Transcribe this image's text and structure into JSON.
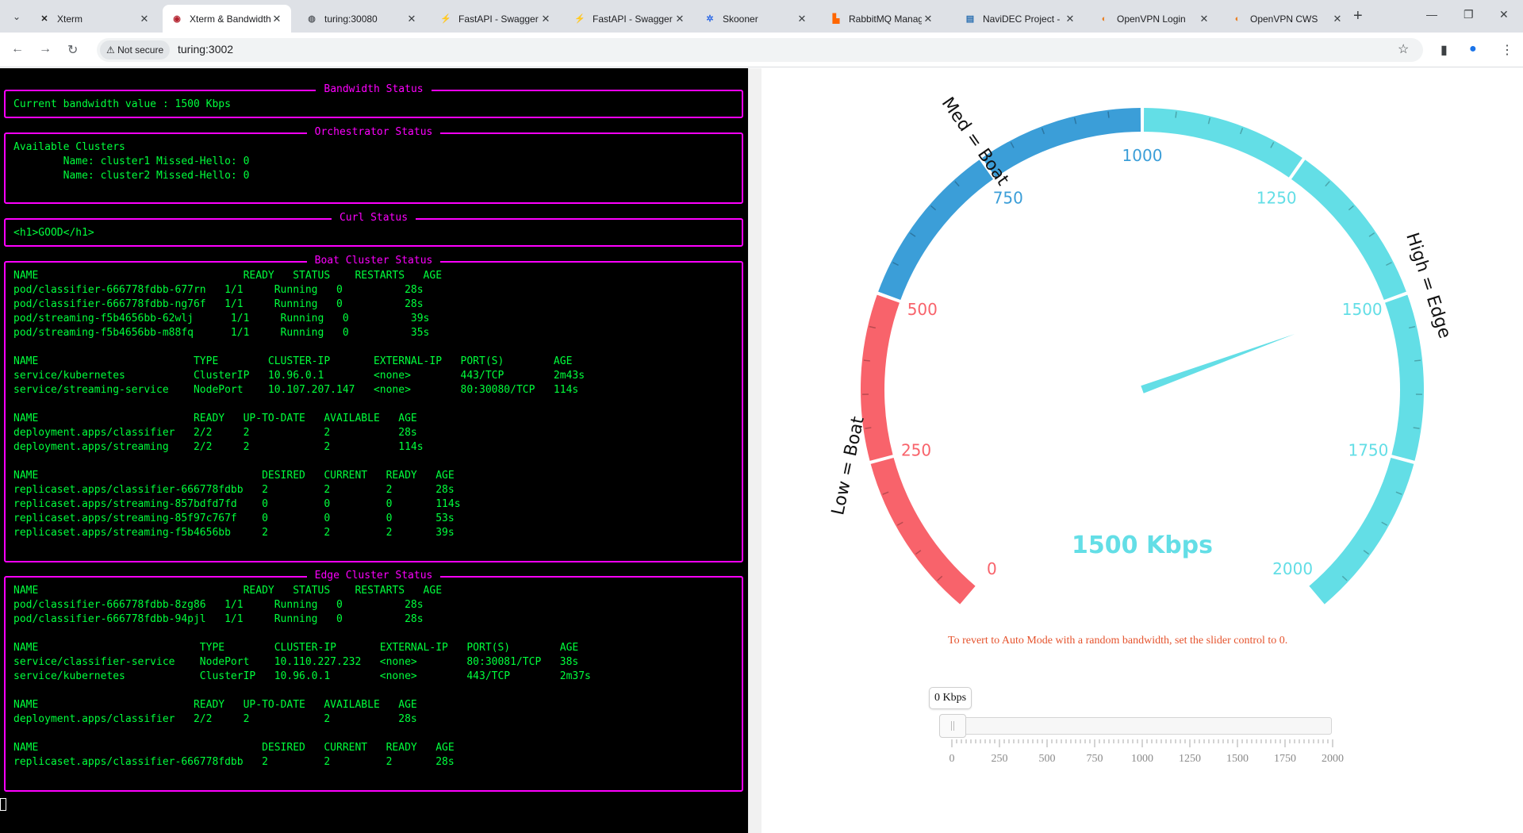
{
  "browser": {
    "tabs": [
      {
        "title": "Xterm",
        "icon": "xterm-icon",
        "active": false
      },
      {
        "title": "Xterm & Bandwidth",
        "icon": "app-icon",
        "active": true
      },
      {
        "title": "turing:30080",
        "icon": "globe-icon",
        "active": false
      },
      {
        "title": "FastAPI - Swagger",
        "icon": "fastapi-icon",
        "active": false
      },
      {
        "title": "FastAPI - Swagger",
        "icon": "fastapi-icon",
        "active": false
      },
      {
        "title": "Skooner",
        "icon": "kubernetes-icon",
        "active": false
      },
      {
        "title": "RabbitMQ Manag",
        "icon": "rabbitmq-icon",
        "active": false
      },
      {
        "title": "NaviDEC Project -",
        "icon": "doc-icon",
        "active": false
      },
      {
        "title": "OpenVPN Login",
        "icon": "openvpn-icon",
        "active": false
      },
      {
        "title": "OpenVPN CWS",
        "icon": "openvpn-icon",
        "active": false
      }
    ],
    "security_label": "Not secure",
    "url": "turing:3002"
  },
  "terminal": {
    "panels": [
      {
        "title": "Bandwidth Status",
        "text": "Current bandwidth value : 1500 Kbps"
      },
      {
        "title": "Orchestrator Status",
        "text": "Available Clusters\n        Name: cluster1 Missed-Hello: 0\n        Name: cluster2 Missed-Hello: 0"
      },
      {
        "title": "Curl Status",
        "text": "<h1>GOOD</h1>"
      },
      {
        "title": "Boat Cluster Status",
        "text": "NAME                                 READY   STATUS    RESTARTS   AGE\npod/classifier-666778fdbb-677rn   1/1     Running   0          28s\npod/classifier-666778fdbb-ng76f   1/1     Running   0          28s\npod/streaming-f5b4656bb-62wlj      1/1     Running   0          39s\npod/streaming-f5b4656bb-m88fq      1/1     Running   0          35s\n\nNAME                         TYPE        CLUSTER-IP       EXTERNAL-IP   PORT(S)        AGE\nservice/kubernetes           ClusterIP   10.96.0.1        <none>        443/TCP        2m43s\nservice/streaming-service    NodePort    10.107.207.147   <none>        80:30080/TCP   114s\n\nNAME                         READY   UP-TO-DATE   AVAILABLE   AGE\ndeployment.apps/classifier   2/2     2            2           28s\ndeployment.apps/streaming    2/2     2            2           114s\n\nNAME                                    DESIRED   CURRENT   READY   AGE\nreplicaset.apps/classifier-666778fdbb   2         2         2       28s\nreplicaset.apps/streaming-857bdfd7fd    0         0         0       114s\nreplicaset.apps/streaming-85f97c767f    0         0         0       53s\nreplicaset.apps/streaming-f5b4656bb     2         2         2       39s"
      },
      {
        "title": "Edge Cluster Status",
        "text": "NAME                                 READY   STATUS    RESTARTS   AGE\npod/classifier-666778fdbb-8zg86   1/1     Running   0          28s\npod/classifier-666778fdbb-94pjl   1/1     Running   0          28s\n\nNAME                          TYPE        CLUSTER-IP       EXTERNAL-IP   PORT(S)        AGE\nservice/classifier-service    NodePort    10.110.227.232   <none>        80:30081/TCP   38s\nservice/kubernetes            ClusterIP   10.96.0.1        <none>        443/TCP        2m37s\n\nNAME                         READY   UP-TO-DATE   AVAILABLE   AGE\ndeployment.apps/classifier   2/2     2            2           28s\n\nNAME                                    DESIRED   CURRENT   READY   AGE\nreplicaset.apps/classifier-666778fdbb   2         2         2       28s"
      }
    ]
  },
  "gauge": {
    "min": 0,
    "max": 2000,
    "value": 1500,
    "readout": "1500 Kbps",
    "tick_labels": [
      "0",
      "250",
      "500",
      "750",
      "1000",
      "1250",
      "1500",
      "1750",
      "2000"
    ],
    "zones": [
      {
        "label": "Low = Boat",
        "from": 0,
        "to": 500,
        "color": "#f8636b"
      },
      {
        "label": "Med = Boat",
        "from": 500,
        "to": 1000,
        "color": "#3b9ed8"
      },
      {
        "label": "High = Edge",
        "from": 1000,
        "to": 2000,
        "color": "#63dee6"
      }
    ],
    "hint": "To revert to Auto Mode with a random bandwidth, set the slider control to 0."
  },
  "slider": {
    "value_label": "0 Kbps",
    "value": 0,
    "min": 0,
    "max": 2000,
    "scale_labels": [
      "0",
      "250",
      "500",
      "750",
      "1000",
      "1250",
      "1500",
      "1750",
      "2000"
    ]
  }
}
